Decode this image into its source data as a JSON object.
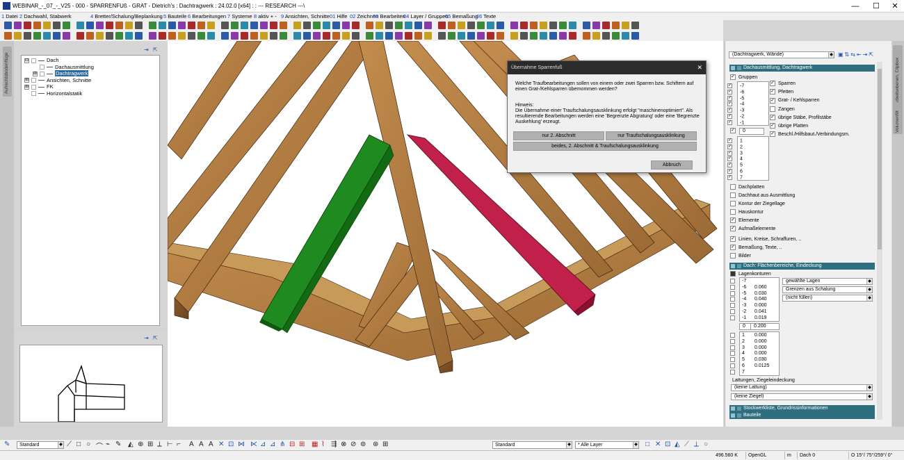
{
  "window": {
    "title": "WEBINAR_-_07_-_V25 - 000 - SPARRENFUß - GRAT - Dietrich's : Dachtragwerk : 24.02.0 [x64] : : --- RESEARCH ---\\",
    "minimize": "—",
    "maximize": "☐",
    "close": "✕"
  },
  "menu": [
    {
      "num": "1",
      "label": "Datei"
    },
    {
      "num": "2",
      "label": "Dachwahl, Stabwerk"
    },
    {
      "num": "4",
      "label": "Bretter/Schalung/Beplankung"
    },
    {
      "num": "5",
      "label": "Bauteile"
    },
    {
      "num": "6",
      "label": "Bearbeitungen"
    },
    {
      "num": "7",
      "label": "Systeme"
    },
    {
      "num": "8",
      "label": "aktiv + -"
    },
    {
      "num": "9",
      "label": "Ansichten, Schnitte"
    },
    {
      "num": "01",
      "label": "Hilfe"
    },
    {
      "num": "02",
      "label": "Zeichnen"
    },
    {
      "num": "03",
      "label": "Bearbeiten"
    },
    {
      "num": "04",
      "label": "Layer / Gruppen"
    },
    {
      "num": "05",
      "label": "Bemaßung"
    },
    {
      "num": "06",
      "label": "Texte"
    }
  ],
  "left_strip_tab": "Aufrechtsbodenflüge",
  "tree": [
    {
      "exp": "⊟",
      "label": "Dach"
    },
    {
      "exp": "",
      "label": "Dachausmittlung"
    },
    {
      "exp": "⊞",
      "label": "Dachtragwerk",
      "selected": true
    },
    {
      "exp": "⊞",
      "label": "Ansichten, Schnitte"
    },
    {
      "exp": "⊞",
      "label": "FK"
    },
    {
      "exp": "",
      "label": "Horizontalstatik"
    }
  ],
  "dialog": {
    "title": "Übernahme Sparrenfuß",
    "question": "Welche Traufbearbeitungen sollen von einem oder zwei Sparren bzw. Schiftern auf einen Grat-/Kehlsparren übernommen werden?",
    "hint_label": "Hinweis:",
    "hint": "Die Übernahme einer Traufschalungsausklinkung erfolgt \"maschinenoptimiert\". Als resultierende Bearbeitungen werden eine 'Begrenzte Abgratung' oder eine 'Begrenzte Auskehlung' erzeugt.",
    "btn_second": "nur 2. Abschnitt",
    "btn_trauf": "nur Traufschalungsausklinkung",
    "btn_both": "beides, 2. Abschnitt & Traufschalungsausklinkung",
    "btn_cancel": "Abbruch"
  },
  "right": {
    "top_select": "(Dachtragwerk, Wände)",
    "section1": "Dachausmittlung, Dachtragwerk",
    "gruppen_label": "Gruppen",
    "groups_neg": [
      "-7",
      "-6",
      "-5",
      "-4",
      "-3",
      "-2",
      "-1"
    ],
    "group_zero": "0",
    "groups_pos": [
      "1",
      "2",
      "3",
      "4",
      "5",
      "6",
      "7"
    ],
    "members": [
      {
        "label": "Sparren",
        "checked": true
      },
      {
        "label": "Pfetten",
        "checked": true
      },
      {
        "label": "Grat- / Kehlsparren",
        "checked": true
      },
      {
        "label": "Zangen",
        "checked": false
      },
      {
        "label": "übrige Stäbe, Profilstäbe",
        "checked": true
      },
      {
        "label": "übrige Platten",
        "checked": true
      },
      {
        "label": "Beschl./Hilfsbaut./Verbindungsm.",
        "checked": true
      }
    ],
    "options": [
      {
        "label": "Dachplatten",
        "checked": false
      },
      {
        "label": "Dachhaut aus Ausmittlung",
        "checked": false
      },
      {
        "label": "Kontur der Ziegellage",
        "checked": false
      },
      {
        "label": "Hauskontur",
        "checked": false
      },
      {
        "label": "Elemente",
        "checked": true
      },
      {
        "label": "Aufmaßelemente",
        "checked": true
      },
      {
        "label": "Linien, Kreise, Schraffuren, ..",
        "checked": true
      },
      {
        "label": "Bemaßung, Texte, ..",
        "checked": true
      },
      {
        "label": "Bilder",
        "checked": false
      }
    ],
    "section2": "Dach: Flächenbereiche, Eindeckung",
    "lagen_label": "Lagenkonturen",
    "lagen_neg": [
      {
        "n": "-7",
        "v": ""
      },
      {
        "n": "-6",
        "v": "0.060"
      },
      {
        "n": "-5",
        "v": "0.030"
      },
      {
        "n": "-4",
        "v": "0.040"
      },
      {
        "n": "-3",
        "v": "0.000"
      },
      {
        "n": "-2",
        "v": "0.041"
      },
      {
        "n": "-1",
        "v": "0.019"
      }
    ],
    "lagen_zero": {
      "n": "0",
      "v": "0.200"
    },
    "lagen_pos": [
      {
        "n": "1",
        "v": "0.000"
      },
      {
        "n": "2",
        "v": "0.000"
      },
      {
        "n": "3",
        "v": "0.000"
      },
      {
        "n": "4",
        "v": "0.000"
      },
      {
        "n": "5",
        "v": "0.030"
      },
      {
        "n": "6",
        "v": "0.0125"
      },
      {
        "n": "7",
        "v": ""
      }
    ],
    "lagen_buttons": [
      "gewählte Lagen",
      "Grenzen aus Schalung",
      "(nicht füllen)"
    ],
    "lattung_label": "Lattungen, Ziegeleindeckung",
    "lattung_select": "(keine Lattung)",
    "ziegel_select": "(keine Ziegel)",
    "section3": "Stockwerkliste, Grundrissinformationen",
    "section4": "Bauteile"
  },
  "right_strip_tabs": [
    "Arbeitsebenen, Clipbox",
    "Volumenfilt"
  ],
  "bottom": {
    "style1": "Standard",
    "style2": "Standard",
    "layer": "* Alle Layer"
  },
  "status": {
    "coord": "496.560 K",
    "renderer": "OpenGL",
    "unit": "m",
    "level": "Dach 0",
    "view": "O 15°/ 75°/259°/  0°"
  },
  "colors": {
    "accent": "#2e6e7e",
    "green_rafter": "#1f8a1f",
    "red_rafter": "#c0204a",
    "timber": "#b07a3e"
  }
}
